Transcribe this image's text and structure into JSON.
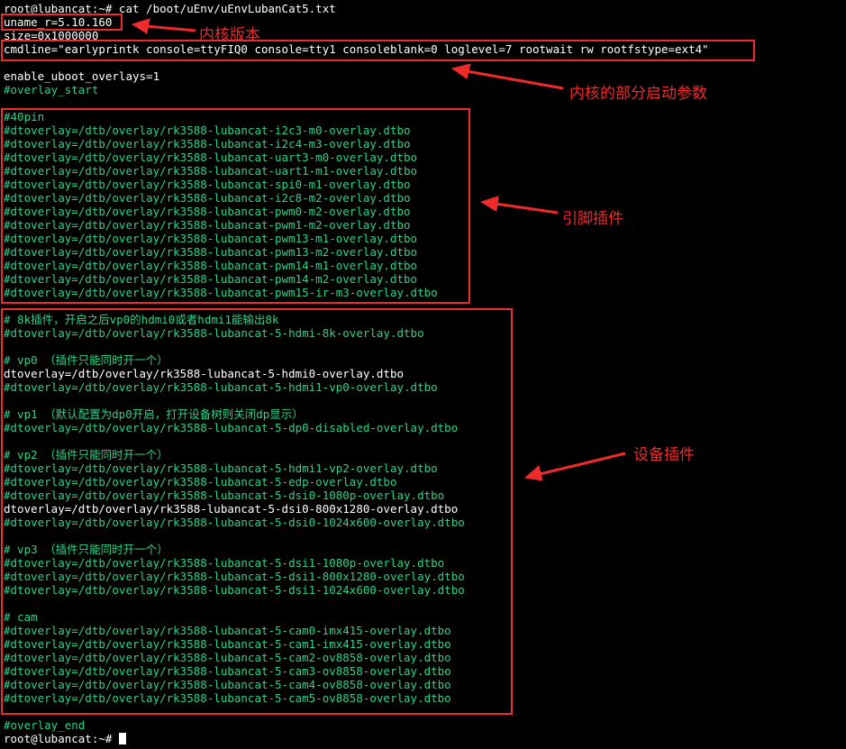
{
  "terminal": {
    "lines": [
      {
        "text": "root@lubancat:~# cat /boot/uEnv/uEnvLubanCat5.txt",
        "color": "white"
      },
      {
        "text": "uname_r=5.10.160",
        "color": "white"
      },
      {
        "text": "size=0x1000000",
        "color": "white"
      },
      {
        "text": "cmdline=\"earlyprintk console=ttyFIQ0 console=tty1 consoleblank=0 loglevel=7 rootwait rw rootfstype=ext4\"",
        "color": "white"
      },
      {
        "text": "",
        "color": "white"
      },
      {
        "text": "enable_uboot_overlays=1",
        "color": "white"
      },
      {
        "text": "#overlay_start",
        "color": "green"
      },
      {
        "text": "",
        "color": "white"
      },
      {
        "text": "#40pin",
        "color": "green"
      },
      {
        "text": "#dtoverlay=/dtb/overlay/rk3588-lubancat-i2c3-m0-overlay.dtbo",
        "color": "green"
      },
      {
        "text": "#dtoverlay=/dtb/overlay/rk3588-lubancat-i2c4-m3-overlay.dtbo",
        "color": "green"
      },
      {
        "text": "#dtoverlay=/dtb/overlay/rk3588-lubancat-uart3-m0-overlay.dtbo",
        "color": "green"
      },
      {
        "text": "#dtoverlay=/dtb/overlay/rk3588-lubancat-uart1-m1-overlay.dtbo",
        "color": "green"
      },
      {
        "text": "#dtoverlay=/dtb/overlay/rk3588-lubancat-spi0-m1-overlay.dtbo",
        "color": "green"
      },
      {
        "text": "#dtoverlay=/dtb/overlay/rk3588-lubancat-i2c8-m2-overlay.dtbo",
        "color": "green"
      },
      {
        "text": "#dtoverlay=/dtb/overlay/rk3588-lubancat-pwm0-m2-overlay.dtbo",
        "color": "green"
      },
      {
        "text": "#dtoverlay=/dtb/overlay/rk3588-lubancat-pwm1-m2-overlay.dtbo",
        "color": "green"
      },
      {
        "text": "#dtoverlay=/dtb/overlay/rk3588-lubancat-pwm13-m1-overlay.dtbo",
        "color": "green"
      },
      {
        "text": "#dtoverlay=/dtb/overlay/rk3588-lubancat-pwm13-m2-overlay.dtbo",
        "color": "green"
      },
      {
        "text": "#dtoverlay=/dtb/overlay/rk3588-lubancat-pwm14-m1-overlay.dtbo",
        "color": "green"
      },
      {
        "text": "#dtoverlay=/dtb/overlay/rk3588-lubancat-pwm14-m2-overlay.dtbo",
        "color": "green"
      },
      {
        "text": "#dtoverlay=/dtb/overlay/rk3588-lubancat-pwm15-ir-m3-overlay.dtbo",
        "color": "green"
      },
      {
        "text": "",
        "color": "white"
      },
      {
        "text": "# 8k插件，开启之后vp0的hdmi0或者hdmi1能输出8k",
        "color": "green"
      },
      {
        "text": "#dtoverlay=/dtb/overlay/rk3588-lubancat-5-hdmi-8k-overlay.dtbo",
        "color": "green"
      },
      {
        "text": "",
        "color": "white"
      },
      {
        "text": "# vp0 （插件只能同时开一个）",
        "color": "green"
      },
      {
        "text": "dtoverlay=/dtb/overlay/rk3588-lubancat-5-hdmi0-overlay.dtbo",
        "color": "white"
      },
      {
        "text": "#dtoverlay=/dtb/overlay/rk3588-lubancat-5-hdmi1-vp0-overlay.dtbo",
        "color": "green"
      },
      {
        "text": "",
        "color": "white"
      },
      {
        "text": "# vp1 （默认配置为dp0开启，打开设备树则关闭dp显示）",
        "color": "green"
      },
      {
        "text": "#dtoverlay=/dtb/overlay/rk3588-lubancat-5-dp0-disabled-overlay.dtbo",
        "color": "green"
      },
      {
        "text": "",
        "color": "white"
      },
      {
        "text": "# vp2 （插件只能同时开一个）",
        "color": "green"
      },
      {
        "text": "#dtoverlay=/dtb/overlay/rk3588-lubancat-5-hdmi1-vp2-overlay.dtbo",
        "color": "green"
      },
      {
        "text": "#dtoverlay=/dtb/overlay/rk3588-lubancat-5-edp-overlay.dtbo",
        "color": "green"
      },
      {
        "text": "#dtoverlay=/dtb/overlay/rk3588-lubancat-5-dsi0-1080p-overlay.dtbo",
        "color": "green"
      },
      {
        "text": "dtoverlay=/dtb/overlay/rk3588-lubancat-5-dsi0-800x1280-overlay.dtbo",
        "color": "white"
      },
      {
        "text": "#dtoverlay=/dtb/overlay/rk3588-lubancat-5-dsi0-1024x600-overlay.dtbo",
        "color": "green"
      },
      {
        "text": "",
        "color": "white"
      },
      {
        "text": "# vp3 （插件只能同时开一个）",
        "color": "green"
      },
      {
        "text": "#dtoverlay=/dtb/overlay/rk3588-lubancat-5-dsi1-1080p-overlay.dtbo",
        "color": "green"
      },
      {
        "text": "#dtoverlay=/dtb/overlay/rk3588-lubancat-5-dsi1-800x1280-overlay.dtbo",
        "color": "green"
      },
      {
        "text": "#dtoverlay=/dtb/overlay/rk3588-lubancat-5-dsi1-1024x600-overlay.dtbo",
        "color": "green"
      },
      {
        "text": "",
        "color": "white"
      },
      {
        "text": "# cam",
        "color": "green"
      },
      {
        "text": "#dtoverlay=/dtb/overlay/rk3588-lubancat-5-cam0-imx415-overlay.dtbo",
        "color": "green"
      },
      {
        "text": "#dtoverlay=/dtb/overlay/rk3588-lubancat-5-cam1-imx415-overlay.dtbo",
        "color": "green"
      },
      {
        "text": "#dtoverlay=/dtb/overlay/rk3588-lubancat-5-cam2-ov8858-overlay.dtbo",
        "color": "green"
      },
      {
        "text": "#dtoverlay=/dtb/overlay/rk3588-lubancat-5-cam3-ov8858-overlay.dtbo",
        "color": "green"
      },
      {
        "text": "#dtoverlay=/dtb/overlay/rk3588-lubancat-5-cam4-ov8858-overlay.dtbo",
        "color": "green"
      },
      {
        "text": "#dtoverlay=/dtb/overlay/rk3588-lubancat-5-cam5-ov8858-overlay.dtbo",
        "color": "green"
      },
      {
        "text": "",
        "color": "white"
      },
      {
        "text": "#overlay_end",
        "color": "green"
      }
    ],
    "prompt": "root@lubancat:~# "
  },
  "annotations": {
    "kernel_version": "内核版本",
    "boot_params": "内核的部分启动参数",
    "pin_plugins": "引脚插件",
    "device_plugins": "设备插件"
  },
  "colors": {
    "background": "#000000",
    "text_white": "#ffffff",
    "text_green": "#2fd18a",
    "annotation_red": "#ee2b2b"
  }
}
